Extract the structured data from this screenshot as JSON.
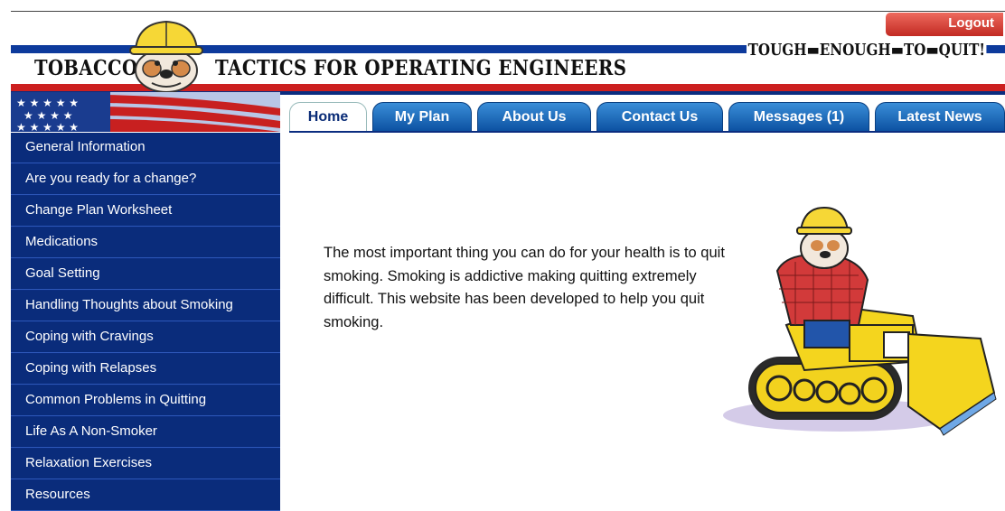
{
  "header": {
    "title_left": "TOBACCO",
    "title_right": "TACTICS FOR OPERATING ENGINEERS",
    "slogan": "TOUGH▬ENOUGH▬TO▬QUIT!",
    "logout_label": "Logout"
  },
  "tabs": [
    {
      "label": "Home"
    },
    {
      "label": "My Plan"
    },
    {
      "label": "About Us"
    },
    {
      "label": "Contact Us"
    },
    {
      "label": "Messages (1)"
    },
    {
      "label": "Latest News"
    }
  ],
  "sidebar": {
    "items": [
      {
        "label": "General Information"
      },
      {
        "label": "Are you ready for a change?"
      },
      {
        "label": "Change Plan Worksheet"
      },
      {
        "label": "Medications"
      },
      {
        "label": "Goal Setting"
      },
      {
        "label": "Handling Thoughts about Smoking"
      },
      {
        "label": "Coping with Cravings"
      },
      {
        "label": "Coping with Relapses"
      },
      {
        "label": "Common Problems in Quitting"
      },
      {
        "label": "Life As A Non-Smoker"
      },
      {
        "label": "Relaxation Exercises"
      },
      {
        "label": "Resources"
      }
    ]
  },
  "main": {
    "intro_text": "The most important thing you can do for your health is to quit smoking. Smoking is addictive making quitting extremely difficult. This website has been developed to help you quit smoking."
  },
  "colors": {
    "nav_blue": "#0b2d80",
    "stripe_red": "#cc1f1f",
    "logout_red": "#c22a22",
    "tab_blue": "#0b4fa0"
  }
}
